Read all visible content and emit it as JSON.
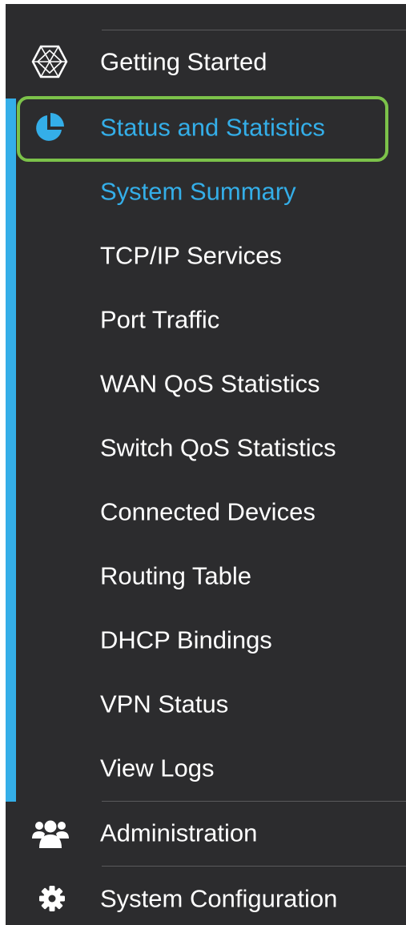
{
  "sidebar": {
    "getting_started": {
      "label": "Getting Started",
      "icon": "getting-started-icon"
    },
    "status": {
      "label": "Status and Statistics",
      "icon": "pie-chart-icon"
    },
    "subitems": [
      "System Summary",
      "TCP/IP Services",
      "Port Traffic",
      "WAN QoS Statistics",
      "Switch QoS Statistics",
      "Connected Devices",
      "Routing Table",
      "DHCP Bindings",
      "VPN Status",
      "View Logs"
    ],
    "administration": {
      "label": "Administration",
      "icon": "users-icon"
    },
    "system_configuration": {
      "label": "System Configuration",
      "icon": "gear-icon"
    }
  },
  "colors": {
    "background": "#2c2c2e",
    "accent": "#34aee8",
    "highlight": "#7cc24a",
    "text": "#ffffff"
  }
}
